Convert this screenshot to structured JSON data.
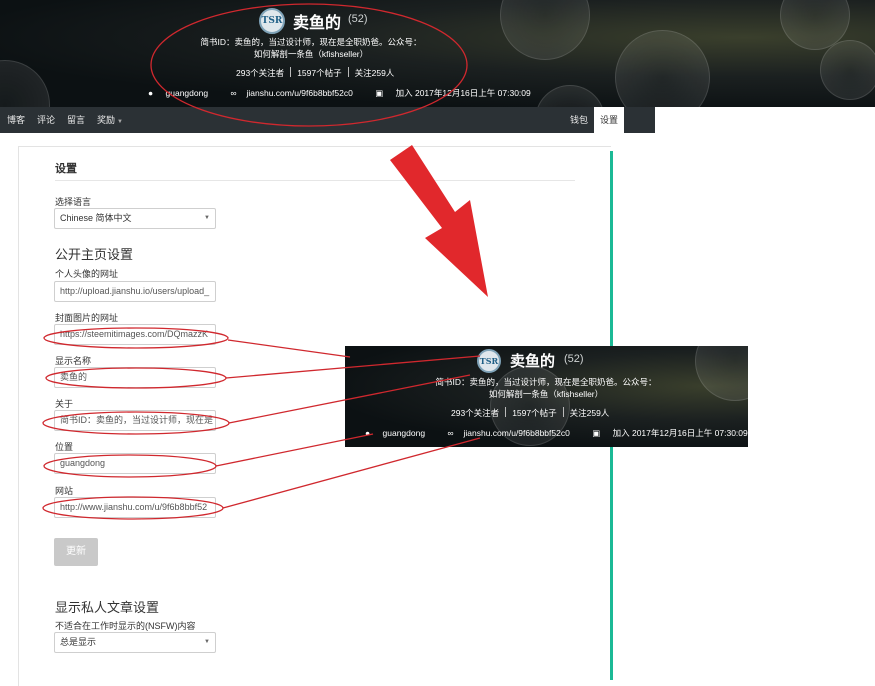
{
  "profile": {
    "name": "卖鱼的",
    "reputation": "(52)",
    "about_line1": "简书ID：卖鱼的，当过设计师，现在是全职奶爸。公众号：",
    "about_line2": "如何解剖一条鱼（kfishseller）",
    "followers": "293个关注者",
    "posts": "1597个帖子",
    "following": "关注259人",
    "location": "guangdong",
    "website": "jianshu.com/u/9f6b8bbf52c0",
    "joined": "加入 2017年12月16日上午 07:30:09",
    "logo_text": "TSR"
  },
  "nav": {
    "items": [
      {
        "label": "博客"
      },
      {
        "label": "评论"
      },
      {
        "label": "留言"
      },
      {
        "label": "奖励"
      }
    ],
    "wallet": "钱包",
    "settings": "设置"
  },
  "settings": {
    "title": "设置",
    "language_label": "选择语言",
    "language_value": "Chinese 简体中文",
    "public_heading": "公开主页设置",
    "avatar_label": "个人头像的网址",
    "avatar_value": "http://upload.jianshu.io/users/upload_",
    "cover_label": "封面图片的网址",
    "cover_value": "https://steemitimages.com/DQmazzK",
    "display_name_label": "显示名称",
    "display_name_value": "卖鱼的",
    "about_label": "关于",
    "about_value": "简书ID：卖鱼的，当过设计师，现在是",
    "location_label": "位置",
    "location_value": "guangdong",
    "website_label": "网站",
    "website_value": "http://www.jianshu.com/u/9f6b8bbf52",
    "update_button": "更新",
    "private_heading": "显示私人文章设置",
    "nsfw_label": "不适合在工作时显示的(NSFW)内容",
    "nsfw_value": "总是显示"
  },
  "colors": {
    "annotation_red": "#d0282e",
    "accent_green": "#1bb995"
  }
}
